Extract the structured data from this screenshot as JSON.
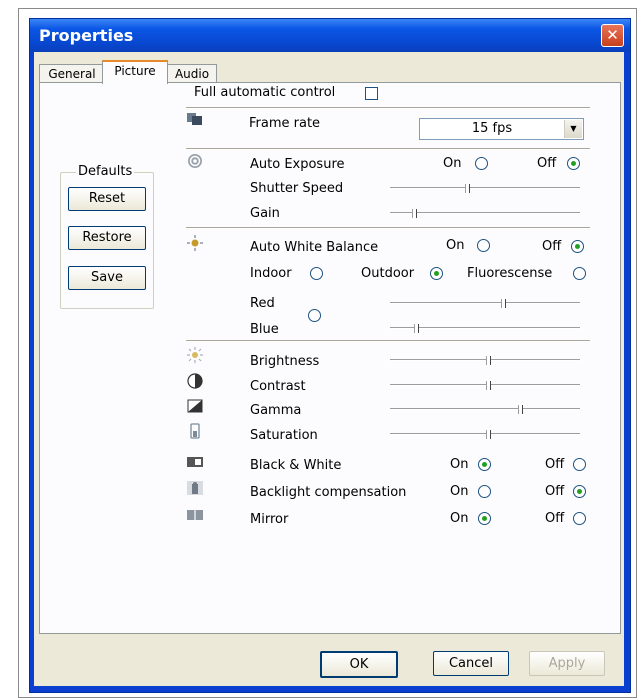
{
  "window": {
    "title": "Properties",
    "close_label": "✕"
  },
  "tabs": [
    {
      "label": "General",
      "active": false
    },
    {
      "label": "Picture",
      "active": true
    },
    {
      "label": "Audio",
      "active": false
    }
  ],
  "full_auto": {
    "label": "Full automatic control",
    "checked": false
  },
  "defaults": {
    "title": "Defaults",
    "reset_label": "Reset",
    "restore_label": "Restore",
    "save_label": "Save"
  },
  "frame_rate": {
    "label": "Frame rate",
    "value": "15 fps"
  },
  "exposure": {
    "label": "Auto Exposure",
    "on_label": "On",
    "off_label": "Off",
    "selected": "Off",
    "shutter_label": "Shutter Speed",
    "shutter_level": 0.4,
    "gain_label": "Gain",
    "gain_level": 0.12
  },
  "white_balance": {
    "label": "Auto White Balance",
    "on_label": "On",
    "off_label": "Off",
    "selected": "Off",
    "indoor_label": "Indoor",
    "outdoor_label": "Outdoor",
    "fluorescent_label": "Fluorescense",
    "preset_selected": "Outdoor",
    "red_label": "Red",
    "red_level": 0.59,
    "blue_label": "Blue",
    "blue_level": 0.13
  },
  "image": {
    "brightness_label": "Brightness",
    "brightness_level": 0.51,
    "contrast_label": "Contrast",
    "contrast_level": 0.51,
    "gamma_label": "Gamma",
    "gamma_level": 0.68,
    "saturation_label": "Saturation",
    "saturation_level": 0.51
  },
  "bw": {
    "label": "Black & White",
    "on_label": "On",
    "off_label": "Off",
    "selected": "On"
  },
  "backlight": {
    "label": "Backlight compensation",
    "on_label": "On",
    "off_label": "Off",
    "selected": "Off"
  },
  "mirror": {
    "label": "Mirror",
    "on_label": "On",
    "off_label": "Off",
    "selected": "On"
  },
  "footer": {
    "ok_label": "OK",
    "cancel_label": "Cancel",
    "apply_label": "Apply",
    "apply_enabled": false
  },
  "colors": {
    "titlebar": "#0b56e5",
    "dialog_bg": "#ece9d8",
    "panel_bg": "#fcfcfe",
    "tab_accent": "#e68b2c"
  }
}
